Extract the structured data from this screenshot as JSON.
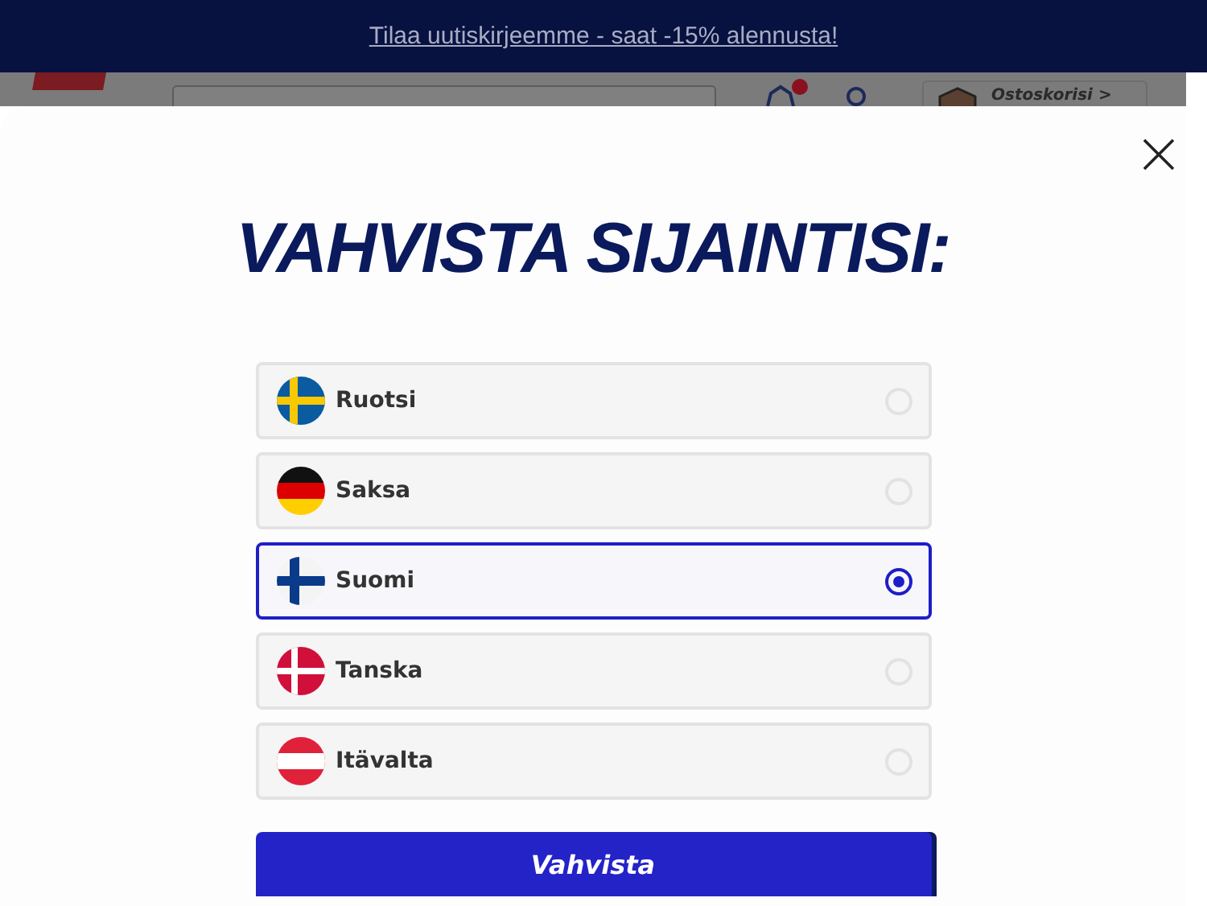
{
  "banner": {
    "link": "Tilaa uutiskirjeemme - saat -15% alennusta!"
  },
  "header": {
    "cart": "Ostoskorisi >",
    "offers_badge": true
  },
  "modal": {
    "title": "VAHVISTA SIJAINTISI:",
    "options": [
      {
        "label": "Ruotsi",
        "kind": "sweden",
        "selected": false
      },
      {
        "label": "Saksa",
        "kind": "germany",
        "selected": false
      },
      {
        "label": "Suomi",
        "kind": "finland",
        "selected": true
      },
      {
        "label": "Tanska",
        "kind": "denmark",
        "selected": false
      },
      {
        "label": "Itävalta",
        "kind": "austria",
        "selected": false
      }
    ],
    "confirm": "Vahvista"
  }
}
